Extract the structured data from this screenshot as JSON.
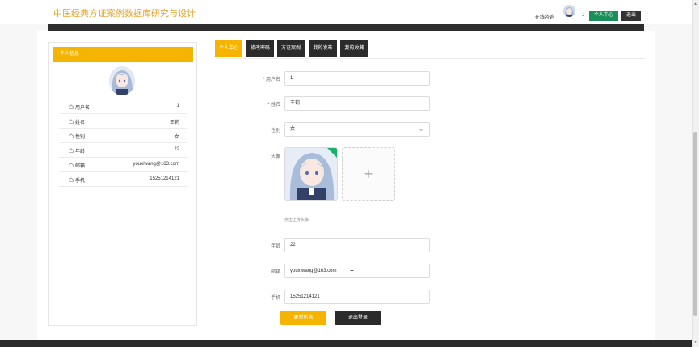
{
  "header": {
    "site_title": "中医经典方证案例数据库研究与设计",
    "online_label": "在线咨询",
    "user_count": "1",
    "center_button": "个人中心",
    "logout_button": "退出"
  },
  "card": {
    "title": "个人信息",
    "rows": [
      {
        "label": "用户名",
        "value": "1"
      },
      {
        "label": "姓名",
        "value": "王莉"
      },
      {
        "label": "性别",
        "value": "女"
      },
      {
        "label": "年龄",
        "value": "22"
      },
      {
        "label": "邮箱",
        "value": "youxiwang@163.com"
      },
      {
        "label": "手机",
        "value": "15251214121"
      }
    ]
  },
  "tabs": [
    {
      "label": "个人中心",
      "active": true
    },
    {
      "label": "修改密码",
      "active": false
    },
    {
      "label": "方证案例",
      "active": false
    },
    {
      "label": "我的发布",
      "active": false
    },
    {
      "label": "我的收藏",
      "active": false
    }
  ],
  "form": {
    "username": {
      "label": "用户名",
      "required_mark": "*",
      "value": "1"
    },
    "name": {
      "label": "姓名",
      "required_mark": "*",
      "value": "王莉"
    },
    "gender": {
      "label": "性别",
      "value": "女"
    },
    "avatar": {
      "label": "头像",
      "tip": "点击上传头像"
    },
    "age": {
      "label": "年龄",
      "value": "22"
    },
    "email": {
      "label": "邮箱",
      "value": "youxiwang@163.com"
    },
    "phone": {
      "label": "手机",
      "value": "15251214121"
    },
    "update_button": "更新信息",
    "exit_button": "退出登录"
  },
  "icons": {
    "row_icon": "user-outline-icon",
    "select_arrow": "chevron-down-icon",
    "add": "plus-icon",
    "upload_ok": "check-corner-icon"
  },
  "colors": {
    "accent": "#f5b400",
    "title": "#e8a32a",
    "dark": "#2b2b2b",
    "green": "#1a8f5a"
  }
}
